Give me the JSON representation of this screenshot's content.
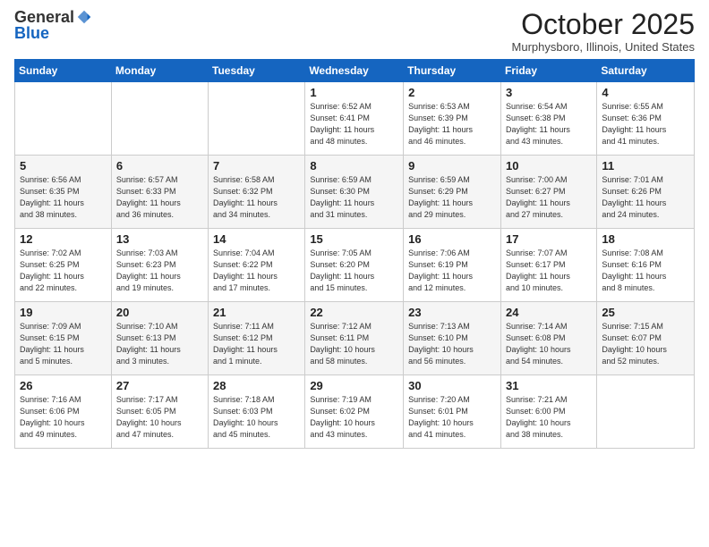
{
  "header": {
    "logo_general": "General",
    "logo_blue": "Blue",
    "month": "October 2025",
    "location": "Murphysboro, Illinois, United States"
  },
  "days_of_week": [
    "Sunday",
    "Monday",
    "Tuesday",
    "Wednesday",
    "Thursday",
    "Friday",
    "Saturday"
  ],
  "weeks": [
    {
      "shade": "white",
      "days": [
        {
          "num": "",
          "info": ""
        },
        {
          "num": "",
          "info": ""
        },
        {
          "num": "",
          "info": ""
        },
        {
          "num": "1",
          "info": "Sunrise: 6:52 AM\nSunset: 6:41 PM\nDaylight: 11 hours\nand 48 minutes."
        },
        {
          "num": "2",
          "info": "Sunrise: 6:53 AM\nSunset: 6:39 PM\nDaylight: 11 hours\nand 46 minutes."
        },
        {
          "num": "3",
          "info": "Sunrise: 6:54 AM\nSunset: 6:38 PM\nDaylight: 11 hours\nand 43 minutes."
        },
        {
          "num": "4",
          "info": "Sunrise: 6:55 AM\nSunset: 6:36 PM\nDaylight: 11 hours\nand 41 minutes."
        }
      ]
    },
    {
      "shade": "shade",
      "days": [
        {
          "num": "5",
          "info": "Sunrise: 6:56 AM\nSunset: 6:35 PM\nDaylight: 11 hours\nand 38 minutes."
        },
        {
          "num": "6",
          "info": "Sunrise: 6:57 AM\nSunset: 6:33 PM\nDaylight: 11 hours\nand 36 minutes."
        },
        {
          "num": "7",
          "info": "Sunrise: 6:58 AM\nSunset: 6:32 PM\nDaylight: 11 hours\nand 34 minutes."
        },
        {
          "num": "8",
          "info": "Sunrise: 6:59 AM\nSunset: 6:30 PM\nDaylight: 11 hours\nand 31 minutes."
        },
        {
          "num": "9",
          "info": "Sunrise: 6:59 AM\nSunset: 6:29 PM\nDaylight: 11 hours\nand 29 minutes."
        },
        {
          "num": "10",
          "info": "Sunrise: 7:00 AM\nSunset: 6:27 PM\nDaylight: 11 hours\nand 27 minutes."
        },
        {
          "num": "11",
          "info": "Sunrise: 7:01 AM\nSunset: 6:26 PM\nDaylight: 11 hours\nand 24 minutes."
        }
      ]
    },
    {
      "shade": "white",
      "days": [
        {
          "num": "12",
          "info": "Sunrise: 7:02 AM\nSunset: 6:25 PM\nDaylight: 11 hours\nand 22 minutes."
        },
        {
          "num": "13",
          "info": "Sunrise: 7:03 AM\nSunset: 6:23 PM\nDaylight: 11 hours\nand 19 minutes."
        },
        {
          "num": "14",
          "info": "Sunrise: 7:04 AM\nSunset: 6:22 PM\nDaylight: 11 hours\nand 17 minutes."
        },
        {
          "num": "15",
          "info": "Sunrise: 7:05 AM\nSunset: 6:20 PM\nDaylight: 11 hours\nand 15 minutes."
        },
        {
          "num": "16",
          "info": "Sunrise: 7:06 AM\nSunset: 6:19 PM\nDaylight: 11 hours\nand 12 minutes."
        },
        {
          "num": "17",
          "info": "Sunrise: 7:07 AM\nSunset: 6:17 PM\nDaylight: 11 hours\nand 10 minutes."
        },
        {
          "num": "18",
          "info": "Sunrise: 7:08 AM\nSunset: 6:16 PM\nDaylight: 11 hours\nand 8 minutes."
        }
      ]
    },
    {
      "shade": "shade",
      "days": [
        {
          "num": "19",
          "info": "Sunrise: 7:09 AM\nSunset: 6:15 PM\nDaylight: 11 hours\nand 5 minutes."
        },
        {
          "num": "20",
          "info": "Sunrise: 7:10 AM\nSunset: 6:13 PM\nDaylight: 11 hours\nand 3 minutes."
        },
        {
          "num": "21",
          "info": "Sunrise: 7:11 AM\nSunset: 6:12 PM\nDaylight: 11 hours\nand 1 minute."
        },
        {
          "num": "22",
          "info": "Sunrise: 7:12 AM\nSunset: 6:11 PM\nDaylight: 10 hours\nand 58 minutes."
        },
        {
          "num": "23",
          "info": "Sunrise: 7:13 AM\nSunset: 6:10 PM\nDaylight: 10 hours\nand 56 minutes."
        },
        {
          "num": "24",
          "info": "Sunrise: 7:14 AM\nSunset: 6:08 PM\nDaylight: 10 hours\nand 54 minutes."
        },
        {
          "num": "25",
          "info": "Sunrise: 7:15 AM\nSunset: 6:07 PM\nDaylight: 10 hours\nand 52 minutes."
        }
      ]
    },
    {
      "shade": "white",
      "days": [
        {
          "num": "26",
          "info": "Sunrise: 7:16 AM\nSunset: 6:06 PM\nDaylight: 10 hours\nand 49 minutes."
        },
        {
          "num": "27",
          "info": "Sunrise: 7:17 AM\nSunset: 6:05 PM\nDaylight: 10 hours\nand 47 minutes."
        },
        {
          "num": "28",
          "info": "Sunrise: 7:18 AM\nSunset: 6:03 PM\nDaylight: 10 hours\nand 45 minutes."
        },
        {
          "num": "29",
          "info": "Sunrise: 7:19 AM\nSunset: 6:02 PM\nDaylight: 10 hours\nand 43 minutes."
        },
        {
          "num": "30",
          "info": "Sunrise: 7:20 AM\nSunset: 6:01 PM\nDaylight: 10 hours\nand 41 minutes."
        },
        {
          "num": "31",
          "info": "Sunrise: 7:21 AM\nSunset: 6:00 PM\nDaylight: 10 hours\nand 38 minutes."
        },
        {
          "num": "",
          "info": ""
        }
      ]
    }
  ]
}
